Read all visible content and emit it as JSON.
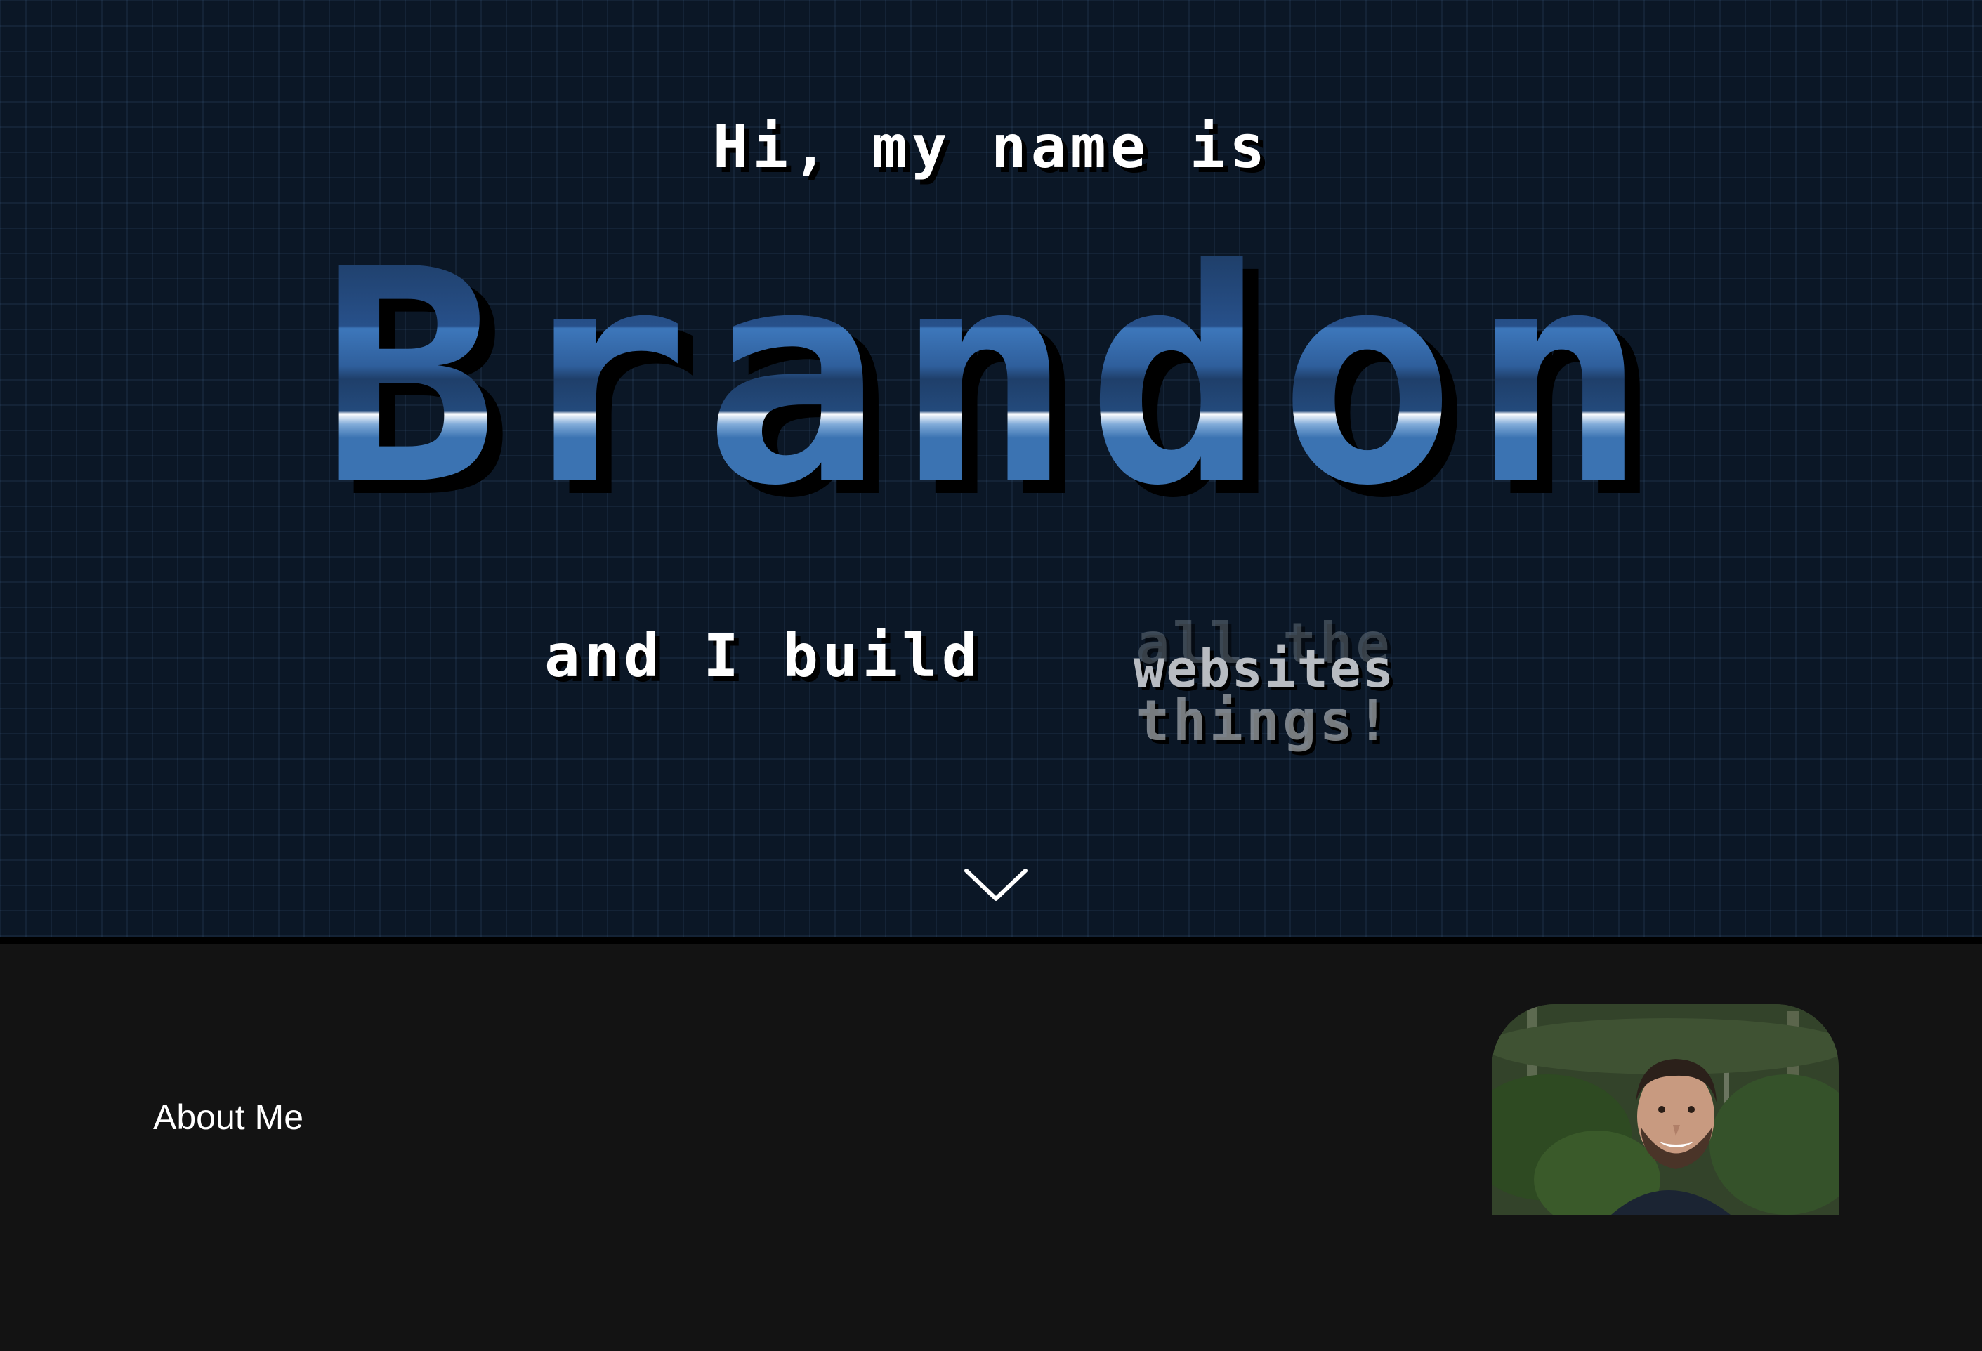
{
  "hero": {
    "intro": "Hi, my name is",
    "name": "Brandon",
    "tagline_prefix": "and I build",
    "rotator": {
      "previous": "all the",
      "current": "websites",
      "next": "things!"
    },
    "scroll_icon": "chevron-down-icon"
  },
  "about": {
    "title": "About Me",
    "portrait_icon": "profile-photo"
  },
  "colors": {
    "hero_bg": "#0b1726",
    "brand_blue": "#3b73b2",
    "page_bg": "#131313",
    "text": "#ffffff"
  }
}
